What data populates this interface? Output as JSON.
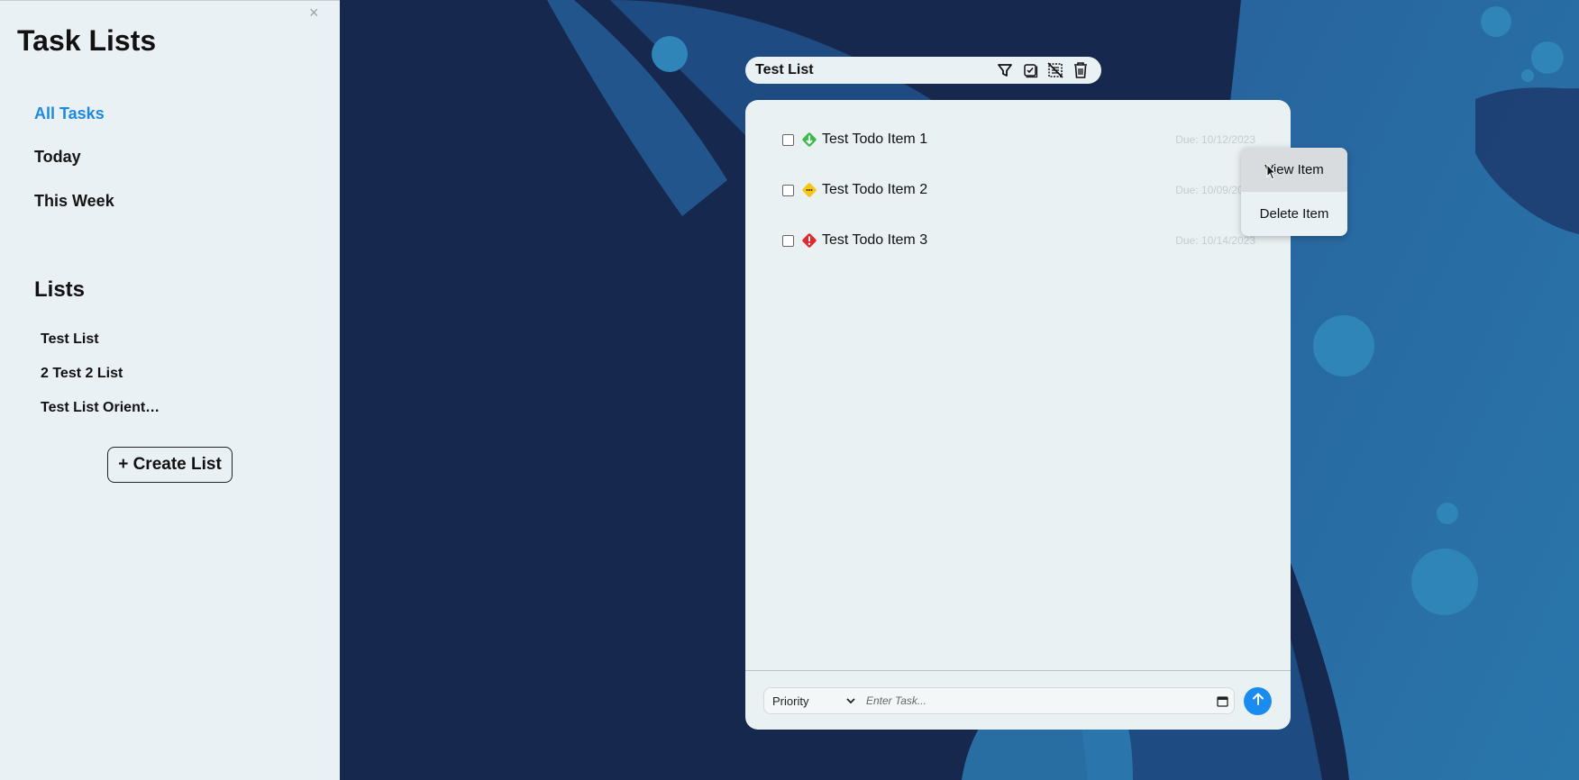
{
  "sidebar": {
    "close_symbol": "×",
    "title": "Task Lists",
    "nav": [
      {
        "label": "All Tasks",
        "active": true
      },
      {
        "label": "Today",
        "active": false
      },
      {
        "label": "This Week",
        "active": false
      }
    ],
    "lists_heading": "Lists",
    "lists": [
      "Test List",
      "2 Test 2 List",
      "Test List Orient…"
    ],
    "create_button": "+ Create List"
  },
  "list_header": {
    "title": "Test List",
    "icons": [
      "filter-icon",
      "check-square-icon",
      "deselect-icon",
      "trash-icon"
    ]
  },
  "todos": [
    {
      "text": "Test Todo Item 1",
      "due": "Due: 10/12/2023",
      "priority": "low",
      "priority_color": "#3dbb51"
    },
    {
      "text": "Test Todo Item 2",
      "due": "Due: 10/09/2023",
      "priority": "medium",
      "priority_color": "#f5c518"
    },
    {
      "text": "Test Todo Item 3",
      "due": "Due: 10/14/2023",
      "priority": "high",
      "priority_color": "#e0282f"
    }
  ],
  "footer": {
    "priority_label": "Priority",
    "task_placeholder": "Enter Task..."
  },
  "context_menu": {
    "items": [
      "View Item",
      "Delete Item"
    ]
  },
  "colors": {
    "accent": "#1e88e5",
    "send_button": "#1a8cf0",
    "background": "#17284f"
  }
}
